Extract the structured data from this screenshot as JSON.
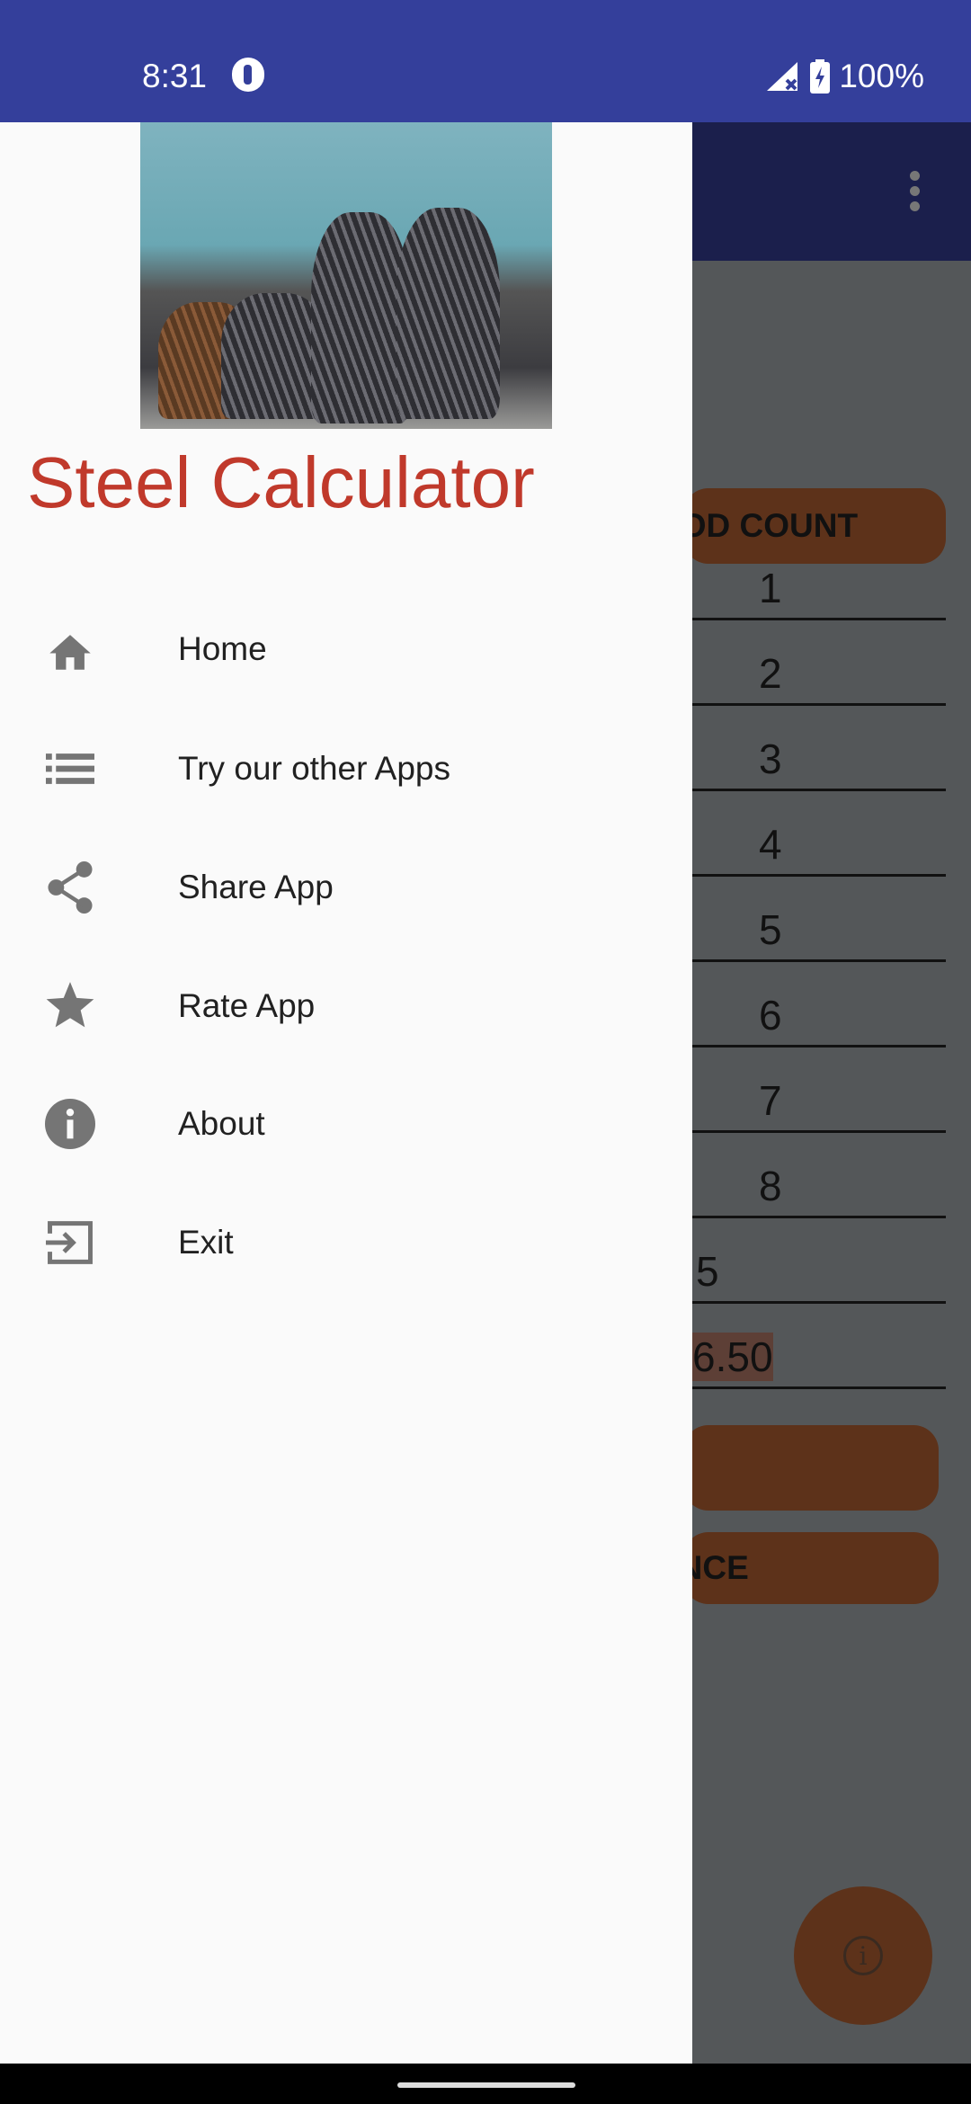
{
  "status_bar": {
    "time": "8:31",
    "battery": "100%"
  },
  "drawer": {
    "title": "Steel Calculator",
    "items": [
      {
        "label": "Home",
        "icon": "home-icon"
      },
      {
        "label": "Try our other Apps",
        "icon": "list-icon"
      },
      {
        "label": "Share App",
        "icon": "share-icon"
      },
      {
        "label": "Rate App",
        "icon": "star-icon"
      },
      {
        "label": "About",
        "icon": "info-icon"
      },
      {
        "label": "Exit",
        "icon": "exit-icon"
      }
    ]
  },
  "background": {
    "header_button": "ROD COUNT",
    "rows": [
      "1",
      "2",
      "3",
      "4",
      "5",
      "6",
      "7",
      "8",
      "5",
      "6.50"
    ],
    "button2": "",
    "button3": "ENCE"
  },
  "colors": {
    "status_bar": "#343f9b",
    "title": "#c0392b",
    "accent": "#e07b39"
  }
}
